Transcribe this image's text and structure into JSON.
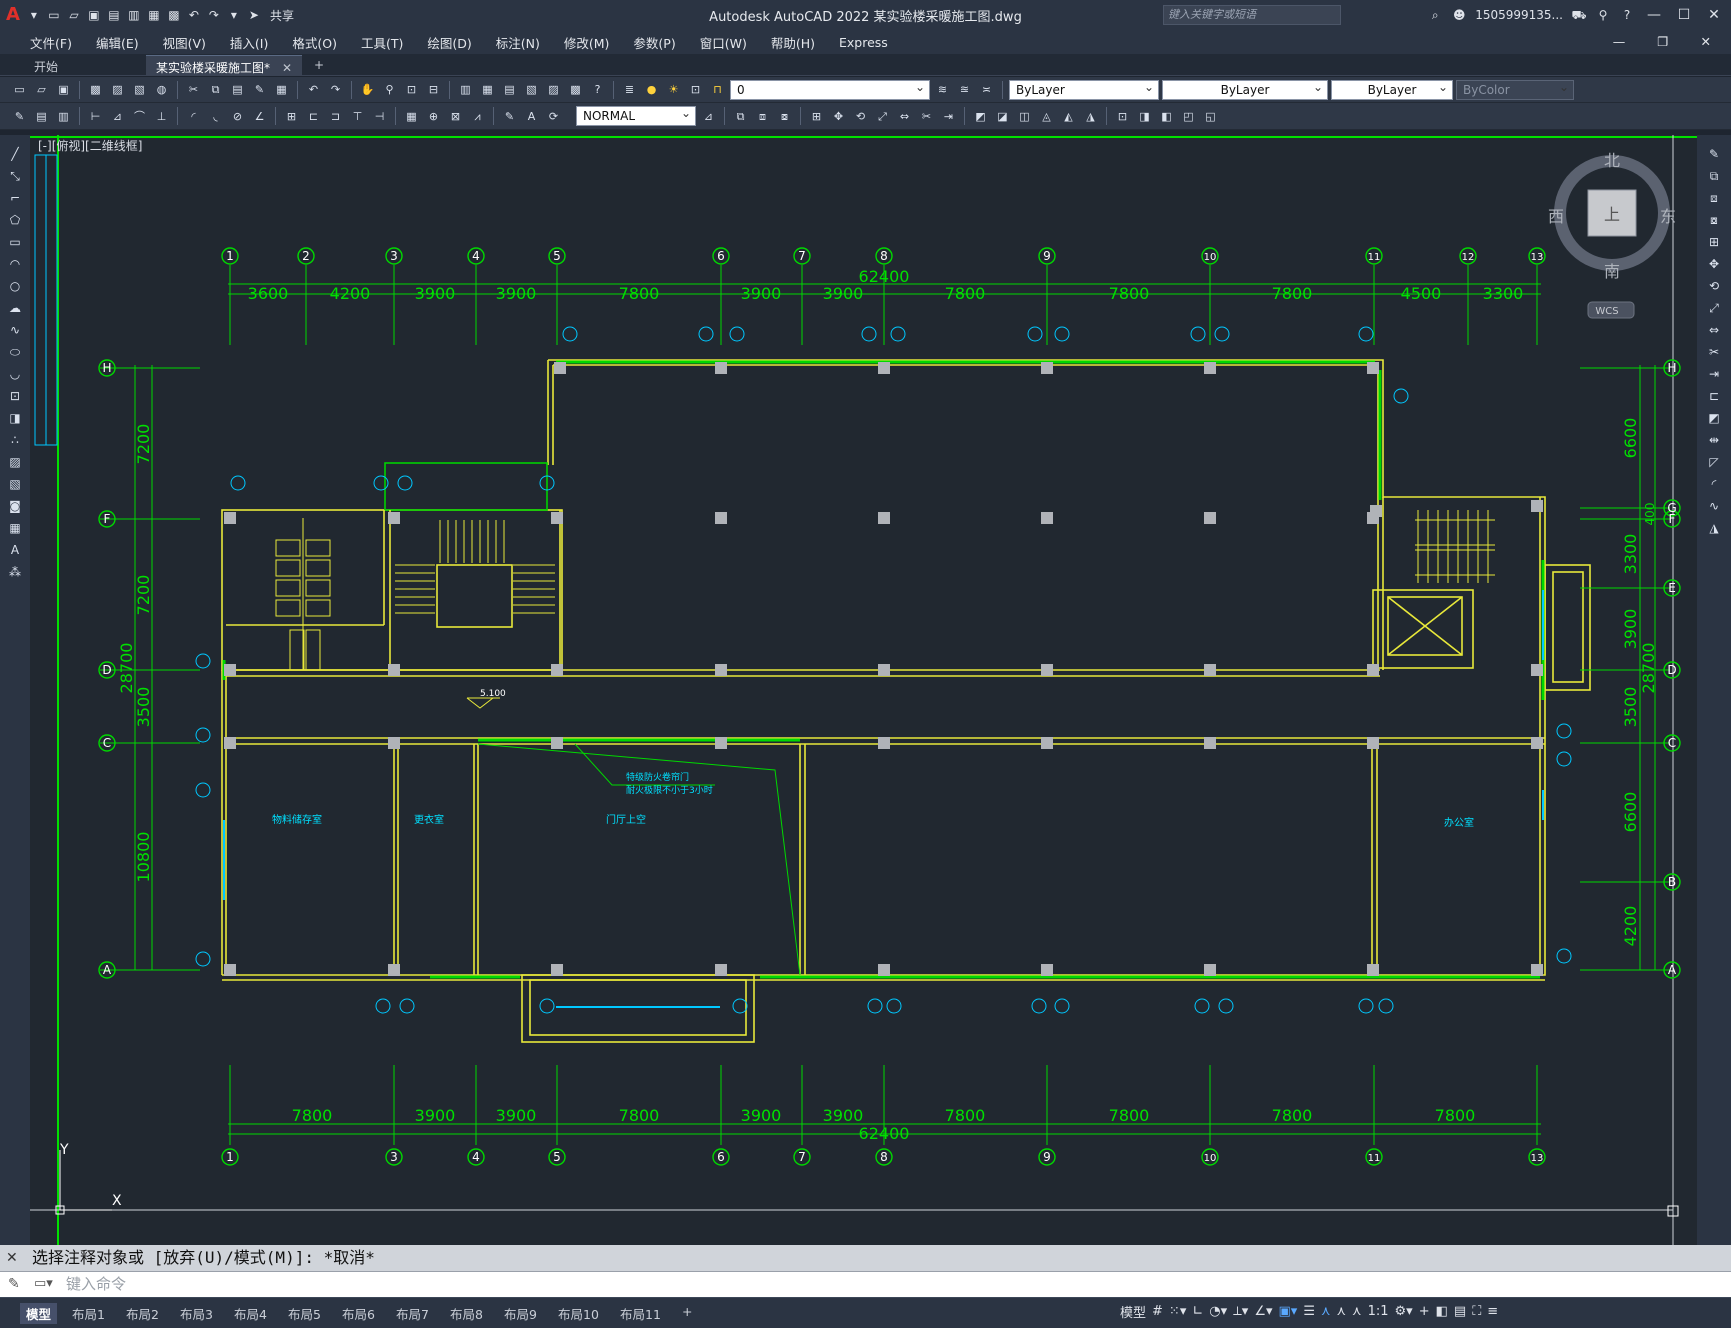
{
  "window": {
    "title": "Autodesk AutoCAD 2022    某实验楼采暖施工图.dwg",
    "search_placeholder": "键入关键字或短语",
    "user": "1505999135...",
    "share": "共享"
  },
  "menu": [
    "文件(F)",
    "编辑(E)",
    "视图(V)",
    "插入(I)",
    "格式(O)",
    "工具(T)",
    "绘图(D)",
    "标注(N)",
    "修改(M)",
    "参数(P)",
    "窗口(W)",
    "帮助(H)",
    "Express"
  ],
  "tabs": {
    "start": "开始",
    "doc": "某实验楼采暖施工图*",
    "close": "✕",
    "add": "+"
  },
  "toolbar": {
    "layer": "0",
    "color": "ByLayer",
    "linetype": "ByLayer",
    "lineweight": "ByLayer",
    "plotstyle": "ByColor",
    "dimstyle": "NORMAL"
  },
  "viewport": {
    "label": "[-][俯视][二维线框]"
  },
  "viewcube": {
    "north": "北",
    "south": "南",
    "east": "东",
    "west": "西",
    "top": "上",
    "wcs": "WCS"
  },
  "drawing": {
    "top_axes": [
      "1",
      "2",
      "3",
      "4",
      "5",
      "6",
      "7",
      "8",
      "9",
      "10",
      "11",
      "12",
      "13"
    ],
    "top_dims": [
      "3600",
      "4200",
      "3900",
      "3900",
      "7800",
      "3900",
      "3900",
      "7800",
      "7800",
      "7800",
      "4500",
      "3300"
    ],
    "bottom_axes": [
      "1",
      "3",
      "4",
      "5",
      "6",
      "7",
      "8",
      "9",
      "10",
      "11",
      "13"
    ],
    "bottom_dims": [
      "7800",
      "3900",
      "3900",
      "7800",
      "3900",
      "3900",
      "7800",
      "7800",
      "7800",
      "7800"
    ],
    "total": "62400",
    "rows": [
      "H",
      "F",
      "D",
      "C",
      "A"
    ],
    "right_rows": [
      "H",
      "G",
      "F",
      "E",
      "D",
      "C",
      "B",
      "A"
    ],
    "left_dims": [
      "7200",
      "7200",
      "3500",
      "10800"
    ],
    "left_total": "28700",
    "right_dims": [
      "6600",
      "3300",
      "3900",
      "3500",
      "6600",
      "4200"
    ],
    "right_small": "400",
    "right_total": "28700",
    "level": "5.100",
    "rooms": [
      "物料储存室",
      "更衣室",
      "门厅上空",
      "办公室"
    ],
    "note1": "特级防火卷帘门",
    "note2": "耐火极限不小于3小时",
    "ucs_y": "Y",
    "ucs_x": "X"
  },
  "command": {
    "history": "选择注释对象或 [放弃(U)/模式(M)]: *取消*",
    "placeholder": "键入命令"
  },
  "layouts": [
    "模型",
    "布局1",
    "布局2",
    "布局3",
    "布局4",
    "布局5",
    "布局6",
    "布局7",
    "布局8",
    "布局9",
    "布局10",
    "布局11",
    "+"
  ],
  "status": {
    "model": "模型",
    "scale": "1:1"
  }
}
